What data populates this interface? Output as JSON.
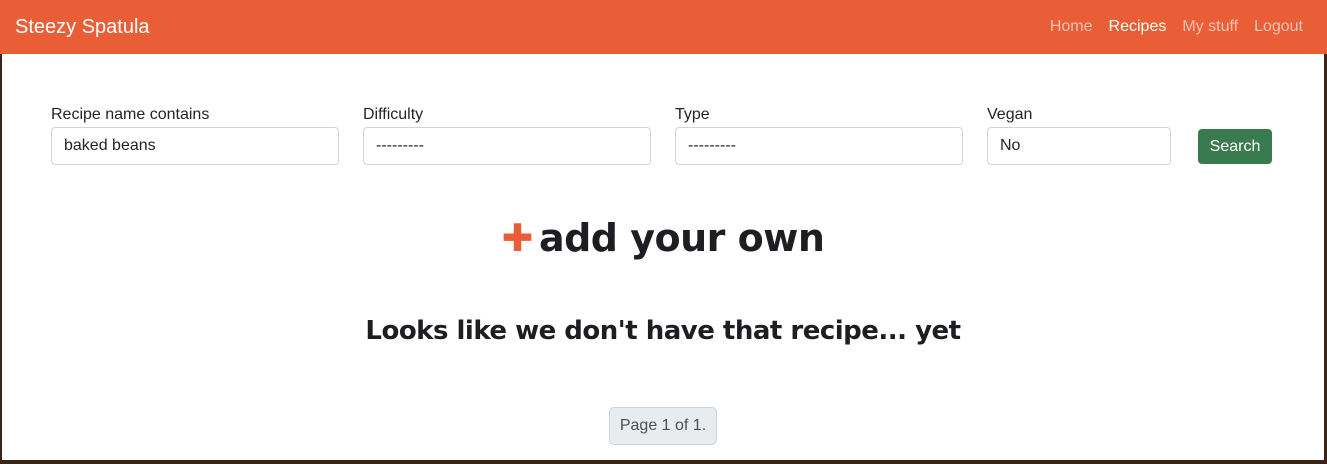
{
  "navbar": {
    "brand": "Steezy Spatula",
    "links": [
      {
        "label": "Home"
      },
      {
        "label": "Recipes"
      },
      {
        "label": "My stuff"
      },
      {
        "label": "Logout"
      }
    ]
  },
  "filters": {
    "name": {
      "label": "Recipe name contains",
      "value": "baked beans"
    },
    "difficulty": {
      "label": "Difficulty",
      "value": "---------"
    },
    "type": {
      "label": "Type",
      "value": "---------"
    },
    "vegan": {
      "label": "Vegan",
      "value": "No"
    },
    "search_label": "Search"
  },
  "add_own": {
    "icon": "plus-icon",
    "glyph": "✚",
    "label": "add your own"
  },
  "empty_message": "Looks like we don't have that recipe... yet",
  "pagination": {
    "label": "Page 1 of 1."
  },
  "colors": {
    "brand": "#ea5e37",
    "search_button": "#3a7a4f",
    "text_dark": "#1e1e22"
  }
}
